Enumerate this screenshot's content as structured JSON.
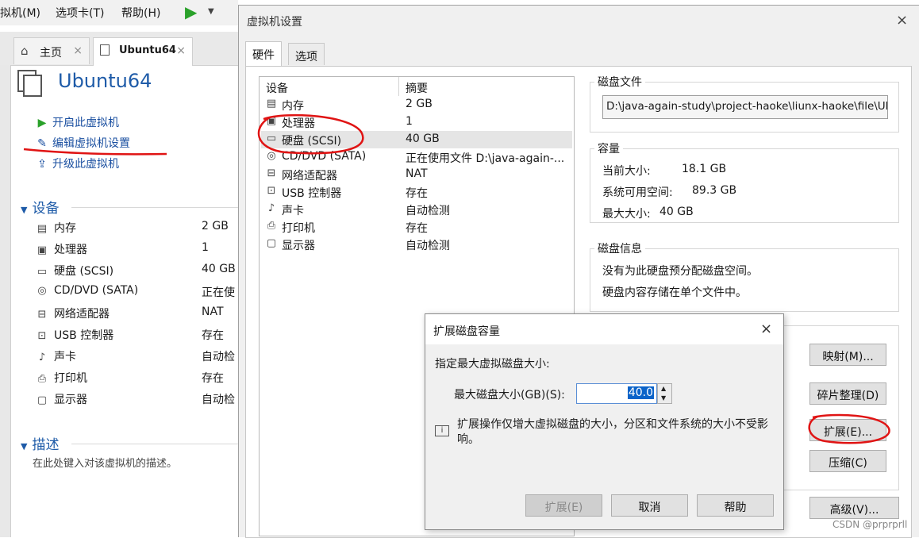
{
  "menu": {
    "items": [
      "拟机(M)",
      "选项卡(T)",
      "帮助(H)"
    ]
  },
  "tabs": [
    {
      "label": "主页",
      "close": "×"
    },
    {
      "label": "Ubuntu64",
      "close": "×"
    }
  ],
  "vm": {
    "title": "Ubuntu64",
    "actions": [
      "开启此虚拟机",
      "编辑虚拟机设置",
      "升级此虚拟机"
    ],
    "devices_header": "设备",
    "devices": [
      {
        "name": "内存",
        "value": "2 GB",
        "icon": "memory-icon"
      },
      {
        "name": "处理器",
        "value": "1",
        "icon": "cpu-icon"
      },
      {
        "name": "硬盘 (SCSI)",
        "value": "40 GB",
        "icon": "disk-icon"
      },
      {
        "name": "CD/DVD (SATA)",
        "value": "正在使",
        "icon": "cd-icon"
      },
      {
        "name": "网络适配器",
        "value": "NAT",
        "icon": "network-icon"
      },
      {
        "name": "USB 控制器",
        "value": "存在",
        "icon": "usb-icon"
      },
      {
        "name": "声卡",
        "value": "自动检",
        "icon": "sound-icon"
      },
      {
        "name": "打印机",
        "value": "存在",
        "icon": "printer-icon"
      },
      {
        "name": "显示器",
        "value": "自动检",
        "icon": "monitor-icon"
      }
    ],
    "desc_header": "描述",
    "desc_placeholder": "在此处键入对该虚拟机的描述。"
  },
  "settings": {
    "title": "虚拟机设置",
    "close": "×",
    "tabs": [
      "硬件",
      "选项"
    ],
    "list_headers": {
      "device": "设备",
      "summary": "摘要"
    },
    "hardware": [
      {
        "name": "内存",
        "summary": "2 GB"
      },
      {
        "name": "处理器",
        "summary": "1"
      },
      {
        "name": "硬盘 (SCSI)",
        "summary": "40 GB"
      },
      {
        "name": "CD/DVD (SATA)",
        "summary": "正在使用文件 D:\\java-again-..."
      },
      {
        "name": "网络适配器",
        "summary": "NAT"
      },
      {
        "name": "USB 控制器",
        "summary": "存在"
      },
      {
        "name": "声卡",
        "summary": "自动检测"
      },
      {
        "name": "打印机",
        "summary": "存在"
      },
      {
        "name": "显示器",
        "summary": "自动检测"
      }
    ],
    "disk_file": {
      "label": "磁盘文件",
      "path": "D:\\java-again-study\\project-haoke\\liunx-haoke\\file\\Ubu"
    },
    "capacity": {
      "label": "容量",
      "current_label": "当前大小:",
      "current": "18.1 GB",
      "free_label": "系统可用空间:",
      "free": "89.3 GB",
      "max_label": "最大大小:",
      "max": "40 GB"
    },
    "disk_info": {
      "label": "磁盘信息",
      "line1": "没有为此硬盘预分配磁盘空间。",
      "line2": "硬盘内容存储在单个文件中。"
    },
    "utility_buttons": {
      "map": "映射(M)...",
      "defrag": "碎片整理(D)",
      "expand": "扩展(E)...",
      "compact": "压缩(C)"
    },
    "advanced_button": "高级(V)..."
  },
  "expand": {
    "title": "扩展磁盘容量",
    "close": "×",
    "prompt": "指定最大虚拟磁盘大小:",
    "size_label": "最大磁盘大小(GB)(S):",
    "size_value": "40.0",
    "info": "扩展操作仅增大虚拟磁盘的大小，分区和文件系统的大小不受影响。",
    "buttons": {
      "expand": "扩展(E)",
      "cancel": "取消",
      "help": "帮助"
    }
  },
  "watermark": "CSDN @prprprll",
  "colors": {
    "accent": "#1e5ba8",
    "annotation": "#e01414",
    "play": "#2aa12a"
  }
}
